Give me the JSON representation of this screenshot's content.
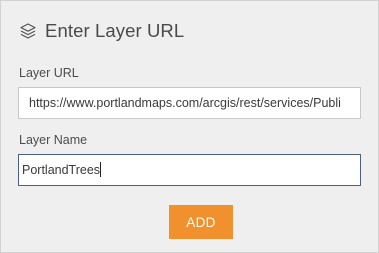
{
  "panel": {
    "title": "Enter Layer URL",
    "title_icon": "layers-icon"
  },
  "layer_url": {
    "label": "Layer URL",
    "value": "https://www.portlandmaps.com/arcgis/rest/services/Publi"
  },
  "layer_name": {
    "label": "Layer Name",
    "value": "PortlandTrees"
  },
  "add_button": {
    "label": "ADD"
  },
  "colors": {
    "panel_bg": "#efefef",
    "accent": "#f0912d",
    "focus_border": "#4e5f87"
  }
}
